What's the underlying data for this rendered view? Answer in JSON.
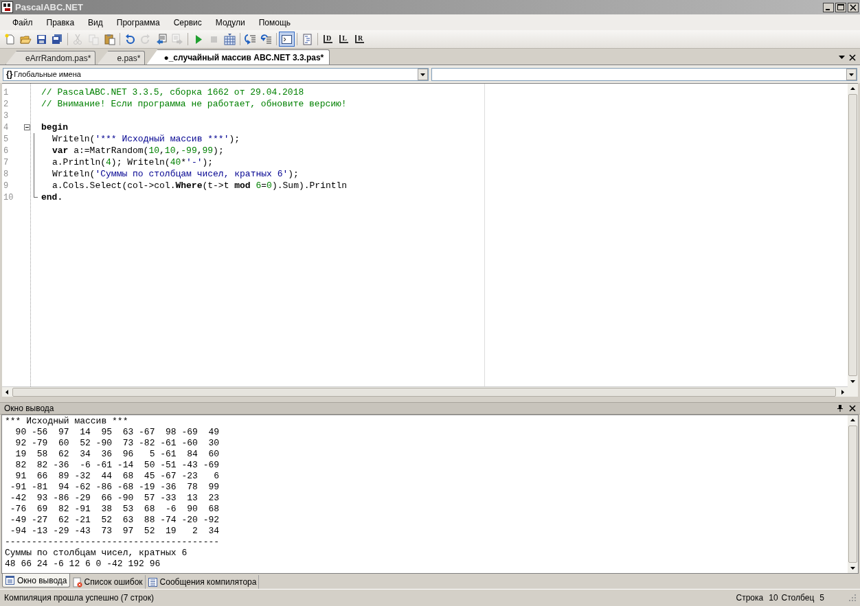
{
  "window": {
    "title": "PascalABC.NET"
  },
  "menu": [
    "Файл",
    "Правка",
    "Вид",
    "Программа",
    "Сервис",
    "Модули",
    "Помощь"
  ],
  "toolbar": [
    {
      "kind": "new",
      "disabled": false,
      "selected": false
    },
    {
      "kind": "open",
      "disabled": false,
      "selected": false
    },
    {
      "kind": "save",
      "disabled": false,
      "selected": false
    },
    {
      "kind": "saveall",
      "disabled": false,
      "selected": false
    },
    {
      "kind": "sep"
    },
    {
      "kind": "cut",
      "disabled": true,
      "selected": false
    },
    {
      "kind": "copy",
      "disabled": true,
      "selected": false
    },
    {
      "kind": "paste",
      "disabled": false,
      "selected": false
    },
    {
      "kind": "sep"
    },
    {
      "kind": "undo",
      "disabled": false,
      "selected": false
    },
    {
      "kind": "redo",
      "disabled": true,
      "selected": false
    },
    {
      "kind": "back",
      "disabled": false,
      "selected": false
    },
    {
      "kind": "forward",
      "disabled": true,
      "selected": false
    },
    {
      "kind": "sep"
    },
    {
      "kind": "run",
      "disabled": false,
      "selected": false
    },
    {
      "kind": "stop",
      "disabled": true,
      "selected": false
    },
    {
      "kind": "compile",
      "disabled": false,
      "selected": false
    },
    {
      "kind": "sep"
    },
    {
      "kind": "stepin",
      "disabled": false,
      "selected": false
    },
    {
      "kind": "stepover",
      "disabled": false,
      "selected": false
    },
    {
      "kind": "sep"
    },
    {
      "kind": "console",
      "disabled": false,
      "selected": true
    },
    {
      "kind": "sep"
    },
    {
      "kind": "format",
      "disabled": false,
      "selected": false
    },
    {
      "kind": "sep"
    },
    {
      "kind": "letter",
      "label": "D",
      "disabled": false,
      "selected": false
    },
    {
      "kind": "letter",
      "label": "L",
      "disabled": false,
      "selected": false
    },
    {
      "kind": "letter",
      "label": "R",
      "disabled": false,
      "selected": false
    }
  ],
  "tabs": [
    {
      "label": "eArrRandom.pas*",
      "selected": false
    },
    {
      "label": "e.pas*",
      "selected": false
    },
    {
      "label": "●_случайный массив ABC.NET 3.3.pas*",
      "selected": true
    }
  ],
  "scope_combo": {
    "icon_text": "{}",
    "value": "Глобальные имена"
  },
  "editor": {
    "lines": [
      {
        "number": "1",
        "tokens": [
          {
            "kind": "comment",
            "text": "// PascalABC.NET 3.3.5, сборка 1662 от 29.04.2018"
          }
        ]
      },
      {
        "number": "2",
        "tokens": [
          {
            "kind": "comment",
            "text": "// Внимание! Если программа не работает, обновите версию!"
          }
        ]
      },
      {
        "number": "3"
      },
      {
        "number": "4",
        "fold_toggle": true,
        "tokens": [
          {
            "kind": "keyword",
            "text": "begin"
          }
        ]
      },
      {
        "number": "5",
        "indented": true,
        "tokens": [
          {
            "kind": "plain",
            "text": "Writeln("
          },
          {
            "kind": "string",
            "text": "'*** Исходный массив ***'"
          },
          {
            "kind": "plain",
            "text": ");"
          }
        ]
      },
      {
        "number": "6",
        "indented": true,
        "tokens": [
          {
            "kind": "keyword",
            "text": "var"
          },
          {
            "kind": "plain",
            "text": " a:=MatrRandom("
          },
          {
            "kind": "number",
            "text": "10"
          },
          {
            "kind": "plain",
            "text": ","
          },
          {
            "kind": "number",
            "text": "10"
          },
          {
            "kind": "plain",
            "text": ","
          },
          {
            "kind": "number",
            "text": "-99"
          },
          {
            "kind": "plain",
            "text": ","
          },
          {
            "kind": "number",
            "text": "99"
          },
          {
            "kind": "plain",
            "text": ");"
          }
        ]
      },
      {
        "number": "7",
        "indented": true,
        "tokens": [
          {
            "kind": "plain",
            "text": "a.Println("
          },
          {
            "kind": "number",
            "text": "4"
          },
          {
            "kind": "plain",
            "text": "); Writeln("
          },
          {
            "kind": "number",
            "text": "40"
          },
          {
            "kind": "plain",
            "text": "*"
          },
          {
            "kind": "string",
            "text": "'-'"
          },
          {
            "kind": "plain",
            "text": ");"
          }
        ]
      },
      {
        "number": "8",
        "indented": true,
        "tokens": [
          {
            "kind": "plain",
            "text": "Writeln("
          },
          {
            "kind": "string",
            "text": "'Суммы по столбцам чисел, кратных 6'"
          },
          {
            "kind": "plain",
            "text": ");"
          }
        ]
      },
      {
        "number": "9",
        "indented": true,
        "tokens": [
          {
            "kind": "plain",
            "text": "a.Cols.Select(col->col."
          },
          {
            "kind": "keyword",
            "text": "Where"
          },
          {
            "kind": "plain",
            "text": "(t->t "
          },
          {
            "kind": "keyword",
            "text": "mod "
          },
          {
            "kind": "number",
            "text": "6"
          },
          {
            "kind": "plain",
            "text": "="
          },
          {
            "kind": "number",
            "text": "0"
          },
          {
            "kind": "plain",
            "text": ").Sum).Println"
          }
        ]
      },
      {
        "number": "10",
        "block_end": true,
        "tokens": [
          {
            "kind": "keyword",
            "text": "end."
          }
        ]
      }
    ]
  },
  "output_panel": {
    "title": "Окно вывода",
    "lines": [
      "*** Исходный массив ***",
      "  90 -56  97  14  95  63 -67  98 -69  49",
      "  92 -79  60  52 -90  73 -82 -61 -60  30",
      "  19  58  62  34  36  96   5 -61  84  60",
      "  82  82 -36  -6 -61 -14  50 -51 -43 -69",
      "  91  66  89 -32  44  68  45 -67 -23   6",
      " -91 -81  94 -62 -86 -68 -19 -36  78  99",
      " -42  93 -86 -29  66 -90  57 -33  13  23",
      " -76  69  82 -91  38  53  68  -6  90  68",
      " -49 -27  62 -21  52  63  88 -74 -20 -92",
      " -94 -13 -29 -43  73  97  52  19   2  34",
      "----------------------------------------",
      "Суммы по столбцам чисел, кратных 6",
      "48 66 24 -6 12 6 0 -42 192 96"
    ]
  },
  "bottom_tabs": [
    {
      "label": "Окно вывода",
      "kind": "output",
      "selected": true
    },
    {
      "label": "Список ошибок",
      "kind": "errors",
      "selected": false
    },
    {
      "label": "Сообщения компилятора",
      "kind": "messages",
      "selected": false
    }
  ],
  "status_bar": {
    "message": "Компиляция прошла успешно (7 строк)",
    "line_label": "Строка",
    "line": "10",
    "column_label": "Столбец",
    "column": "5"
  }
}
